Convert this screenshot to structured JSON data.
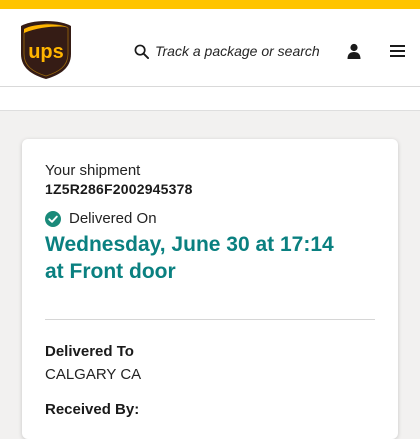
{
  "colors": {
    "brand_yellow": "#ffc400",
    "brand_brown": "#351c15",
    "accent_teal": "#0a8080",
    "status_green": "#1a8a7a"
  },
  "brand": {
    "logo_text": "ups"
  },
  "header": {
    "search_placeholder": "Track a package or search",
    "icons": [
      "search-icon",
      "user-icon",
      "menu-icon"
    ]
  },
  "shipment": {
    "heading": "Your shipment",
    "tracking_number": "1Z5R286F2002945378",
    "status_label": "Delivered On",
    "delivered_line1": "Wednesday, June 30 at 17:14",
    "delivered_line2": "at Front door"
  },
  "details": {
    "delivered_to_title": "Delivered To",
    "delivered_to_value": "CALGARY CA",
    "received_by_title": "Received By:"
  }
}
